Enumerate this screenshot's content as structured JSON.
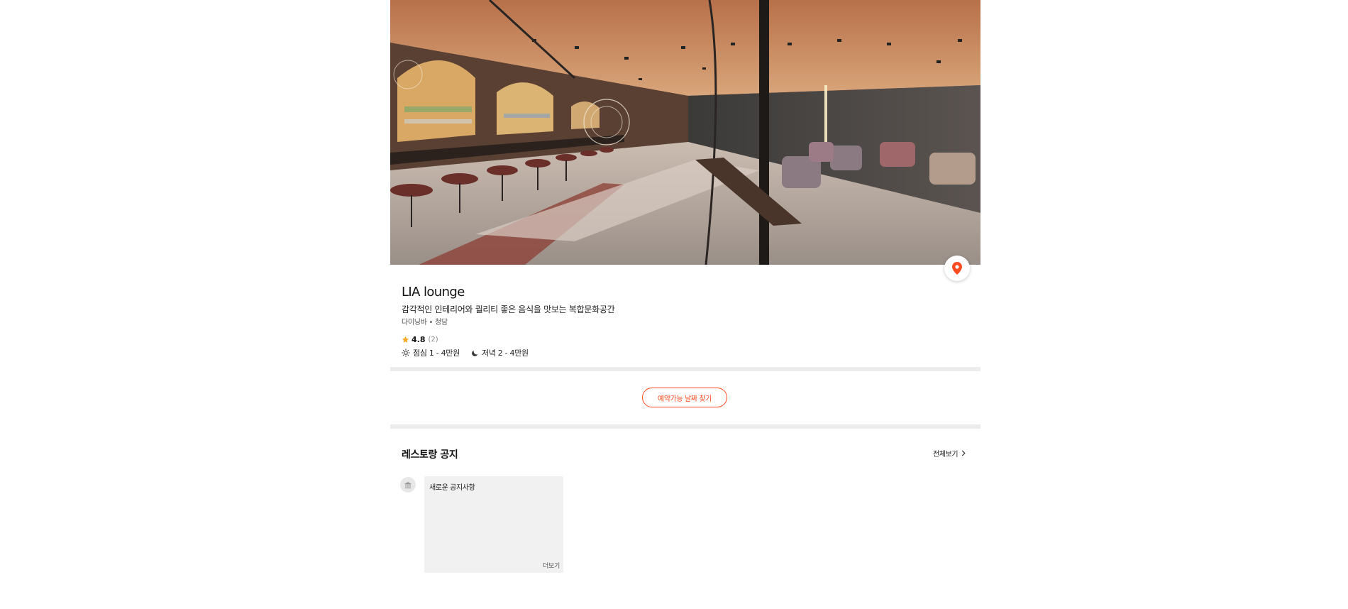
{
  "restaurant": {
    "name": "LIA lounge",
    "description": "감각적인 인테리어와 퀄리티 좋은 음식을 맛보는 복합문화공간",
    "category": "다이닝바 • 청담",
    "rating": "4.8",
    "review_count": "(2)",
    "lunch_price": "점심 1 - 4만원",
    "dinner_price": "저녁 2 - 4만원"
  },
  "reservation": {
    "find_dates_label": "예약가능 날짜 찾기"
  },
  "notice": {
    "section_title": "레스토랑 공지",
    "see_all_label": "전체보기",
    "items": [
      {
        "text": "새로운 공지사항",
        "more_label": "더보기"
      }
    ]
  },
  "colors": {
    "accent": "#ff4b1f",
    "star": "#f5a623",
    "divider": "#ececec"
  },
  "icons": {
    "map": "location-pin-icon",
    "star": "star-icon",
    "lunch": "sun-icon",
    "dinner": "moon-icon",
    "chevron": "chevron-right-icon",
    "avatar": "restaurant-building-icon"
  }
}
